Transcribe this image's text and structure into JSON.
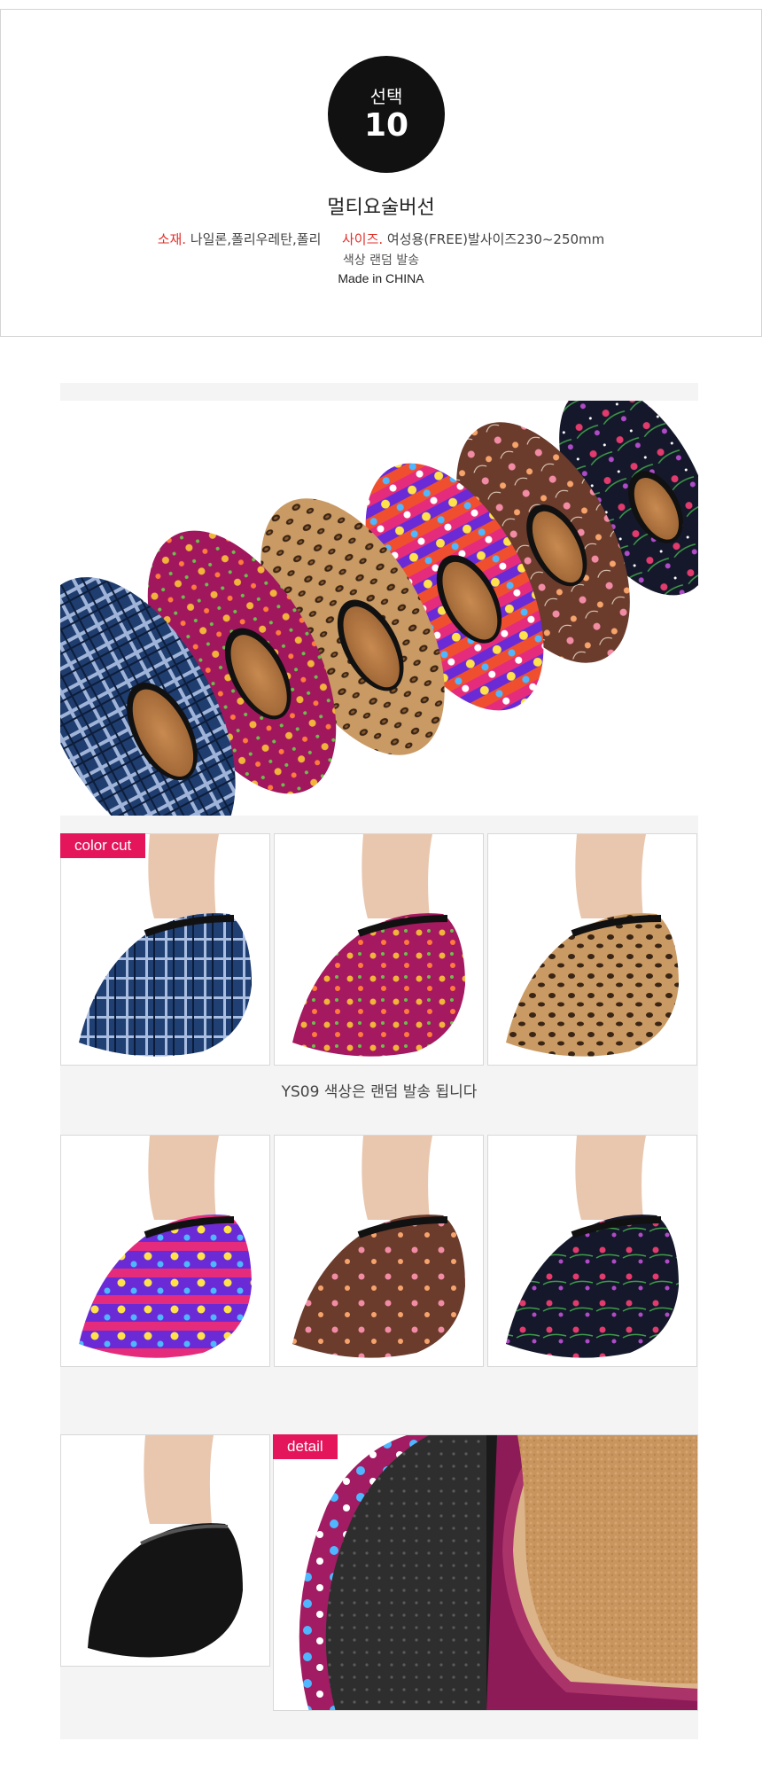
{
  "info": {
    "badge_label": "선택",
    "badge_number": "10",
    "product_name": "멀티요술버선",
    "material_label": "소재.",
    "material_value": "나일론,폴리우레탄,폴리",
    "size_label": "사이즈.",
    "size_value": "여성용(FREE)발사이즈230~250mm",
    "color_note": "색상 랜덤 발송",
    "origin": "Made in CHINA"
  },
  "gallery": {
    "color_cut_tag": "color cut",
    "caption": "YS09 색상은 랜덤 발송 됩니다",
    "detail_tag": "detail"
  },
  "colors": {
    "tag_pink": "#e4155b",
    "accent_red": "#e2302a",
    "badge_black": "#111111"
  },
  "patterns": [
    "blue-plaid",
    "magenta-floral",
    "leopard",
    "pop-letters",
    "brown-floral",
    "navy-floral",
    "solid-black"
  ]
}
